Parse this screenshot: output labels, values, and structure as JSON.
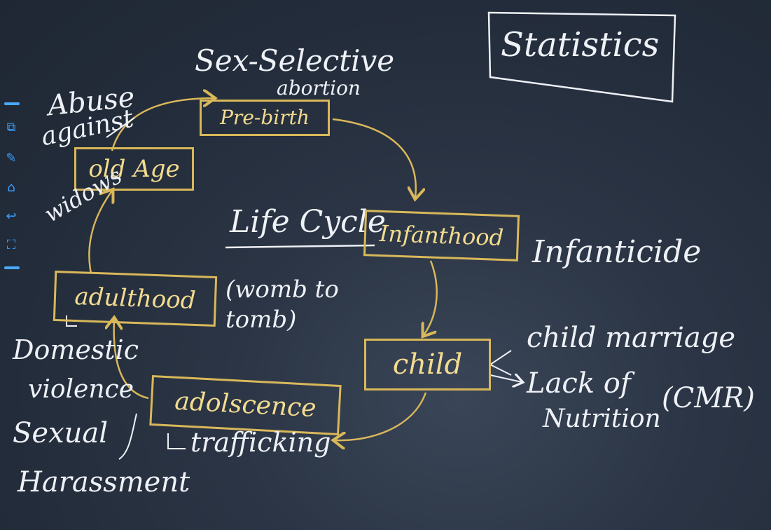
{
  "title": "Statistics",
  "center": {
    "title": "Life Cycle",
    "subtitle": "(womb to tomb)"
  },
  "stages": {
    "pre_birth": "Pre-birth",
    "infanthood": "Infanthood",
    "child": "child",
    "adolescence": "adolscence",
    "adulthood": "adulthood",
    "old_age": "old Age"
  },
  "issues": {
    "pre_birth_1": "Sex-Selective",
    "pre_birth_2": "abortion",
    "infanthood": "Infanticide",
    "child_1": "child marriage",
    "child_2": "Lack of",
    "child_3": "Nutrition",
    "child_4": "(CMR)",
    "adolescence": "trafficking",
    "adulthood_1": "Domestic",
    "adulthood_2": "violence",
    "adulthood_3": "Sexual",
    "adulthood_4": "Harassment",
    "old_age_1": "Abuse",
    "old_age_2": "against",
    "old_age_3": "widows"
  },
  "toolbar": {
    "icons": [
      "screen-share-icon",
      "pencil-icon",
      "home-icon",
      "undo-icon",
      "fullscreen-icon"
    ]
  },
  "colors": {
    "board": "#2b3545",
    "chalk": "#eef1f6",
    "stage": "#d9b85a"
  }
}
